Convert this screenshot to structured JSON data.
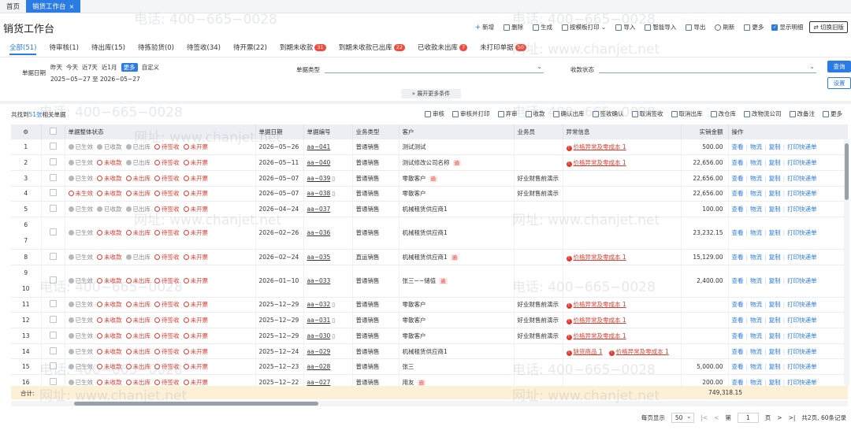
{
  "window_tabs": [
    {
      "label": "首页"
    },
    {
      "label": "销货工作台",
      "close": "×"
    }
  ],
  "title": "销货工作台",
  "toolbar": {
    "add": "新增",
    "delete": "删除",
    "generate": "生成",
    "print_template": "按模板打印",
    "import": "导入",
    "smart_import": "智能导入",
    "export": "导出",
    "refresh": "刷新",
    "more": "更多",
    "show_detail": "显示明细",
    "switch": "切换旧版"
  },
  "status_tabs": [
    {
      "label": "全部(51)",
      "badge": ""
    },
    {
      "label": "待审核(1)",
      "badge": ""
    },
    {
      "label": "待出库(15)",
      "badge": ""
    },
    {
      "label": "待拣验货(0)",
      "badge": ""
    },
    {
      "label": "待签收(34)",
      "badge": ""
    },
    {
      "label": "待开票(22)",
      "badge": ""
    },
    {
      "label": "到期未收款",
      "badge": "31"
    },
    {
      "label": "到期未收款已出库",
      "badge": "22"
    },
    {
      "label": "已收款未出库",
      "badge": "7"
    },
    {
      "label": "未打印单据",
      "badge": "50"
    }
  ],
  "filters": {
    "date_label": "单据日期",
    "date_chips": [
      "昨天",
      "今天",
      "近7天",
      "近1月",
      "更多",
      "自定义"
    ],
    "date_range": "2025−05−27 至 2026−05−27",
    "type_label": "单据类型",
    "pay_label": "收款状态",
    "query": "查询",
    "settings": "设置",
    "expand": "展开更多条件"
  },
  "found": {
    "prefix": "共找到",
    "count": "51张",
    "suffix": "相关单据"
  },
  "actions": [
    "审核",
    "审核并打印",
    "弃审",
    "收款",
    "确认出库",
    "签收确认",
    "取消签收",
    "取消出库",
    "改仓库",
    "改物流公司",
    "改备注",
    "更多"
  ],
  "columns": [
    "",
    "",
    "单据整体状态",
    "单据日期",
    "单据编号",
    "业务类型",
    "客户",
    "业务员",
    "异常信息",
    "实销金额",
    "操作"
  ],
  "status_labels": {
    "s1": "已生效",
    "s1n": "未生效",
    "s2": "已收款",
    "s2n": "未收款",
    "s3": "已出库",
    "s3n": "未出库",
    "s4": "待签收",
    "s5": "未开票"
  },
  "ops": [
    "查看",
    "物流",
    "复制",
    "打印快递单"
  ],
  "tags": {
    "overdue": "逾"
  },
  "rows": [
    {
      "no": "1",
      "s": [
        1,
        1,
        1,
        0,
        0
      ],
      "date": "2026−05−26",
      "bill": "aa−041",
      "phone": false,
      "type": "普通销售",
      "customer": "测试测试",
      "tag": false,
      "staff": "",
      "warn": [
        "价格异常及零成本 1"
      ],
      "amount": "500.00"
    },
    {
      "no": "2",
      "s": [
        1,
        0,
        1,
        0,
        0
      ],
      "date": "2026−05−11",
      "bill": "aa−040",
      "phone": false,
      "type": "普通销售",
      "customer": "测试修改公司名称",
      "tag": true,
      "staff": "",
      "warn": [
        "价格异常及零成本 1"
      ],
      "amount": "22,656.00"
    },
    {
      "no": "3",
      "s": [
        1,
        0,
        0,
        0,
        0
      ],
      "date": "2026−05−07",
      "bill": "aa−039",
      "phone": true,
      "type": "普通销售",
      "customer": "零散客户",
      "tag": true,
      "staff": "好业财售前演示",
      "warn": [],
      "amount": "22,656.00"
    },
    {
      "no": "4",
      "s": [
        0,
        0,
        0,
        0,
        0
      ],
      "date": "2026−05−07",
      "bill": "aa−038",
      "phone": true,
      "type": "普通销售",
      "customer": "零散客户",
      "tag": false,
      "staff": "好业财售前演示",
      "warn": [],
      "amount": "22,656.00"
    },
    {
      "no": "5",
      "s": [
        1,
        1,
        1,
        0,
        0
      ],
      "date": "2026−04−24",
      "bill": "aa−037",
      "phone": false,
      "type": "普通销售",
      "customer": "机械租赁供应商1",
      "tag": false,
      "staff": "",
      "warn": [],
      "amount": "100.00"
    },
    {
      "no": "6",
      "no2": "7",
      "s": [
        1,
        0,
        0,
        0,
        0
      ],
      "date": "2026−02−26",
      "bill": "aa−036",
      "phone": false,
      "type": "普通销售",
      "customer": "机械租赁供应商1",
      "tag": false,
      "staff": "",
      "warn": [],
      "amount": "23,232.15",
      "two": true
    },
    {
      "no": "8",
      "s": [
        1,
        0,
        1,
        0,
        0
      ],
      "date": "2026−02−24",
      "bill": "aa−035",
      "phone": false,
      "type": "直运销售",
      "customer": "机械租赁供应商1",
      "tag": true,
      "staff": "",
      "warn": [
        "价格异常及零成本 1"
      ],
      "amount": "15,129.00"
    },
    {
      "no": "9",
      "no2": "10",
      "s": [
        1,
        0,
        0,
        0,
        0
      ],
      "date": "2026−01−10",
      "bill": "aa−033",
      "phone": false,
      "type": "普通销售",
      "customer": "张三−−储值",
      "tag": true,
      "staff": "",
      "warn": [],
      "amount": "2,400.00",
      "two": true
    },
    {
      "no": "11",
      "s": [
        1,
        0,
        0,
        0,
        0
      ],
      "date": "2025−12−29",
      "bill": "aa−032",
      "phone": true,
      "type": "普通销售",
      "customer": "零散客户",
      "tag": false,
      "staff": "好业财售前演示",
      "warn": [
        "价格异常及零成本 1"
      ],
      "amount": ""
    },
    {
      "no": "12",
      "s": [
        1,
        0,
        0,
        0,
        0
      ],
      "date": "2025−12−29",
      "bill": "aa−031",
      "phone": true,
      "type": "普通销售",
      "customer": "零散客户",
      "tag": false,
      "staff": "好业财售前演示",
      "warn": [
        "价格异常及零成本 1"
      ],
      "amount": ""
    },
    {
      "no": "13",
      "s": [
        1,
        0,
        0,
        0,
        0
      ],
      "date": "2025−12−29",
      "bill": "aa−030",
      "phone": true,
      "type": "普通销售",
      "customer": "零散客户",
      "tag": false,
      "staff": "好业财售前演示",
      "warn": [
        "价格异常及零成本 1"
      ],
      "amount": ""
    },
    {
      "no": "14",
      "s": [
        1,
        0,
        0,
        0,
        0
      ],
      "date": "2025−12−24",
      "bill": "aa−029",
      "phone": false,
      "type": "普通销售",
      "customer": "机械租赁供应商1",
      "tag": false,
      "staff": "",
      "warn": [
        "缺货商品 1",
        "价格异常及零成本 1"
      ],
      "amount": ""
    },
    {
      "no": "15",
      "s": [
        1,
        0,
        0,
        0,
        0
      ],
      "date": "2025−12−23",
      "bill": "aa−028",
      "phone": false,
      "type": "普通销售",
      "customer": "张三",
      "tag": false,
      "staff": "",
      "warn": [],
      "amount": "5,000.00"
    },
    {
      "no": "16",
      "s": [
        1,
        0,
        0,
        0,
        0
      ],
      "date": "2025−12−22",
      "bill": "aa−027",
      "phone": false,
      "type": "普通销售",
      "customer": "用友",
      "tag": true,
      "staff": "",
      "warn": [],
      "amount": "200.00"
    }
  ],
  "total": {
    "label": "合计:",
    "amount": "749,318.15"
  },
  "pager": {
    "per_page_label": "每页显示",
    "per_page": "50",
    "first": "|<",
    "prev": "<",
    "page_label": "第",
    "page": "1",
    "page_suffix": "页",
    "next": ">",
    "last": ">|",
    "summary": "共2页, 60条记录"
  },
  "watermarks": [
    "电话: 400−665−0028",
    "网址: www.chanjet.net"
  ],
  "colors": {
    "primary": "#2a7be4",
    "danger": "#e23a2e",
    "total_bg": "#fcf0d6"
  }
}
